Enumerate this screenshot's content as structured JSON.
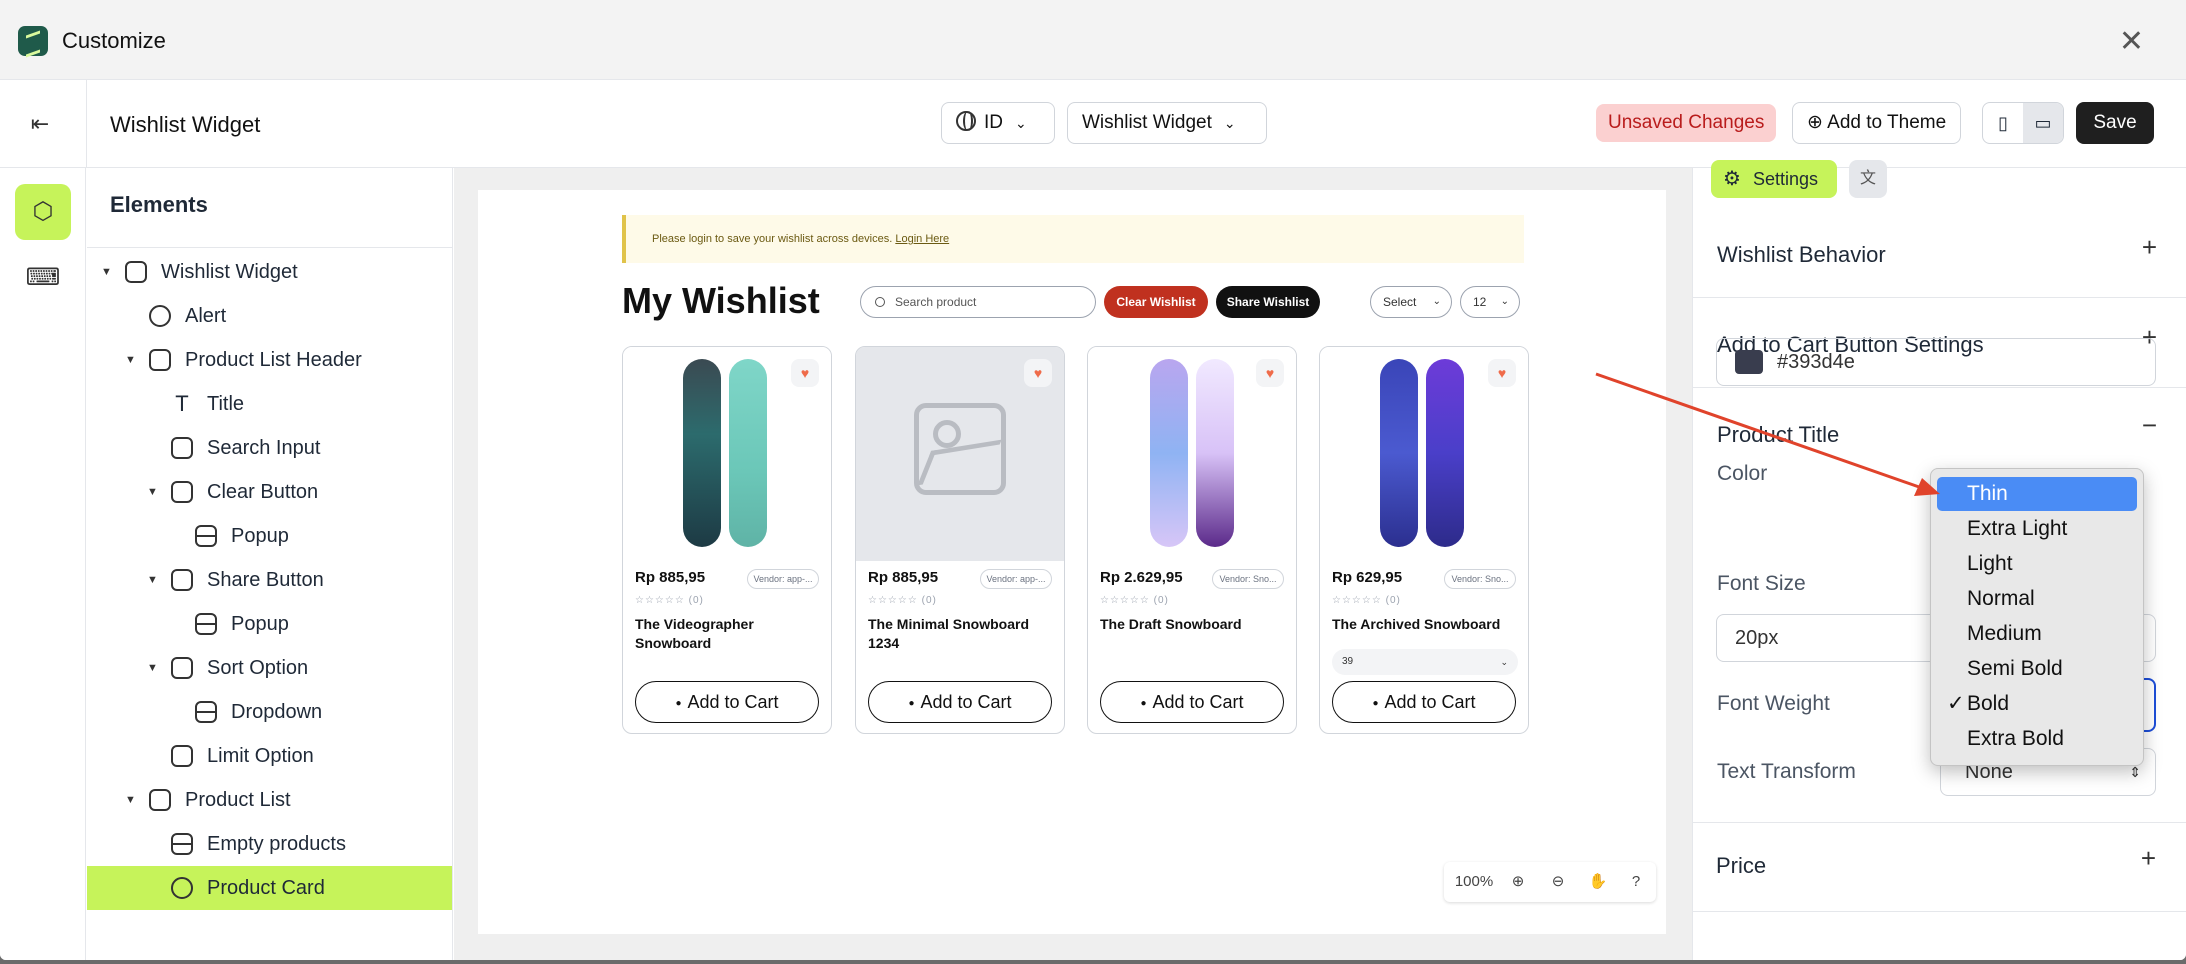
{
  "app": {
    "title": "Customize",
    "close_icon": "close-icon"
  },
  "topbar": {
    "page_title": "Wishlist Widget",
    "language": "ID",
    "template": "Wishlist Widget",
    "unsaved": "Unsaved Changes",
    "add_to_theme": "Add to Theme",
    "save": "Save"
  },
  "elements": {
    "heading": "Elements",
    "tree": [
      {
        "label": "Wishlist Widget",
        "icon": "widget-icon"
      },
      {
        "label": "Alert",
        "icon": "question-circle-icon"
      },
      {
        "label": "Product List Header",
        "icon": "widget-icon"
      },
      {
        "label": "Title",
        "icon": "text-icon"
      },
      {
        "label": "Search Input",
        "icon": "input-icon"
      },
      {
        "label": "Clear Button",
        "icon": "button-icon"
      },
      {
        "label": "Popup",
        "icon": "rows-icon"
      },
      {
        "label": "Share Button",
        "icon": "button-icon"
      },
      {
        "label": "Popup",
        "icon": "rows-icon"
      },
      {
        "label": "Sort Option",
        "icon": "button-icon"
      },
      {
        "label": "Dropdown",
        "icon": "rows-icon"
      },
      {
        "label": "Limit Option",
        "icon": "button-icon"
      },
      {
        "label": "Product List",
        "icon": "widget-icon"
      },
      {
        "label": "Empty products",
        "icon": "rows-icon"
      },
      {
        "label": "Product Card",
        "icon": "card-icon"
      }
    ]
  },
  "preview": {
    "alert_text": "Please login to save your wishlist across devices.",
    "alert_link": "Login Here",
    "title": "My Wishlist",
    "search_placeholder": "Search product",
    "clear_wishlist": "Clear Wishlist",
    "share_wishlist": "Share Wishlist",
    "sort_select": "Select",
    "limit_select": "12",
    "add_to_cart": "Add to Cart",
    "products": [
      {
        "price": "Rp 885,95",
        "vendor": "Vendor: app-...",
        "reviews": "(0)",
        "name": "The Videographer Snowboard",
        "variant": ""
      },
      {
        "price": "Rp 885,95",
        "vendor": "Vendor: app-...",
        "reviews": "(0)",
        "name": "The Minimal Snowboard 1234",
        "variant": ""
      },
      {
        "price": "Rp 2.629,95",
        "vendor": "Vendor: Sno...",
        "reviews": "(0)",
        "name": "The Draft Snowboard",
        "variant": ""
      },
      {
        "price": "Rp 629,95",
        "vendor": "Vendor: Sno...",
        "reviews": "(0)",
        "name": "The Archived Snowboard",
        "variant": "39"
      }
    ],
    "zoom": "100%"
  },
  "panel": {
    "tab_settings": "Settings",
    "sections": {
      "behavior": "Wishlist Behavior",
      "atc": "Add to Cart Button Settings",
      "product_title": "Product Title",
      "price": "Price"
    },
    "color_label": "Color",
    "color_value": "#393d4e",
    "font_size_label": "Font Size",
    "font_size_value": "20px",
    "font_weight_label": "Font Weight",
    "text_transform_label": "Text Transform",
    "text_transform_value": "None"
  },
  "font_weight_menu": {
    "options": [
      "Thin",
      "Extra Light",
      "Light",
      "Normal",
      "Medium",
      "Semi Bold",
      "Bold",
      "Extra Bold"
    ],
    "highlighted": "Thin",
    "checked": "Bold"
  },
  "colors": {
    "accent": "#c6f35a",
    "save_bg": "#1f1f1f",
    "unsaved_bg": "#fbd0d0",
    "clear_btn": "#c0311f",
    "menu_highlight": "#4a8cf5",
    "annotation_arrow": "#e0432b"
  }
}
